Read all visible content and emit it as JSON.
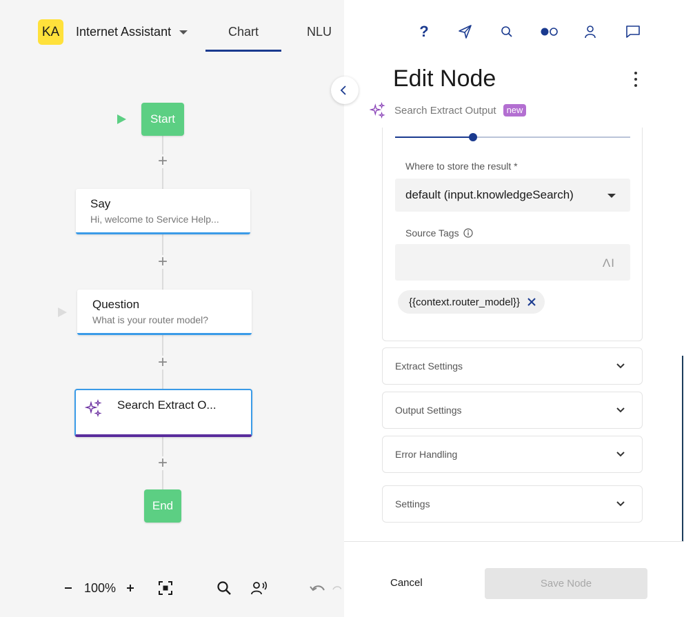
{
  "app": {
    "avatar_initials": "KA",
    "project_name": "Internet Assistant",
    "tabs": [
      {
        "label": "Chart",
        "active": true
      },
      {
        "label": "NLU",
        "active": false
      }
    ]
  },
  "flow": {
    "start_label": "Start",
    "end_label": "End",
    "nodes": [
      {
        "type": "say",
        "title": "Say",
        "subtitle": "Hi, welcome to Service Help..."
      },
      {
        "type": "question",
        "title": "Question",
        "subtitle": "What is your router model?"
      },
      {
        "type": "search-extract-output",
        "title": "Search Extract O..."
      }
    ],
    "colors": {
      "start_end": "#5ccf83",
      "node_accent": "#3a9be8",
      "selected_accent": "#5a2d9c"
    }
  },
  "toolbar": {
    "zoom": "100%",
    "icons": [
      "zoom-out-icon",
      "zoom-in-icon",
      "fit-view-icon",
      "search-icon",
      "voice-preview-icon",
      "undo-icon",
      "redo-icon"
    ]
  },
  "panel": {
    "title": "Edit Node",
    "node_type_label": "Search Extract Output",
    "new_badge": "new",
    "slider": {
      "value_fraction": 0.33
    },
    "store_result": {
      "label": "Where to store the result *",
      "value": "default (input.knowledgeSearch)"
    },
    "source_tags": {
      "label": "Source Tags",
      "ai_icon_text": "ΛI",
      "chips": [
        "{{context.router_model}}"
      ]
    },
    "accordions": [
      "Extract Settings",
      "Output Settings",
      "Error Handling",
      "Settings"
    ],
    "cancel_label": "Cancel",
    "save_label": "Save Node",
    "top_icons": [
      "help-icon",
      "compass-icon",
      "search-icon",
      "toggle-icon",
      "user-icon",
      "chat-icon"
    ]
  }
}
